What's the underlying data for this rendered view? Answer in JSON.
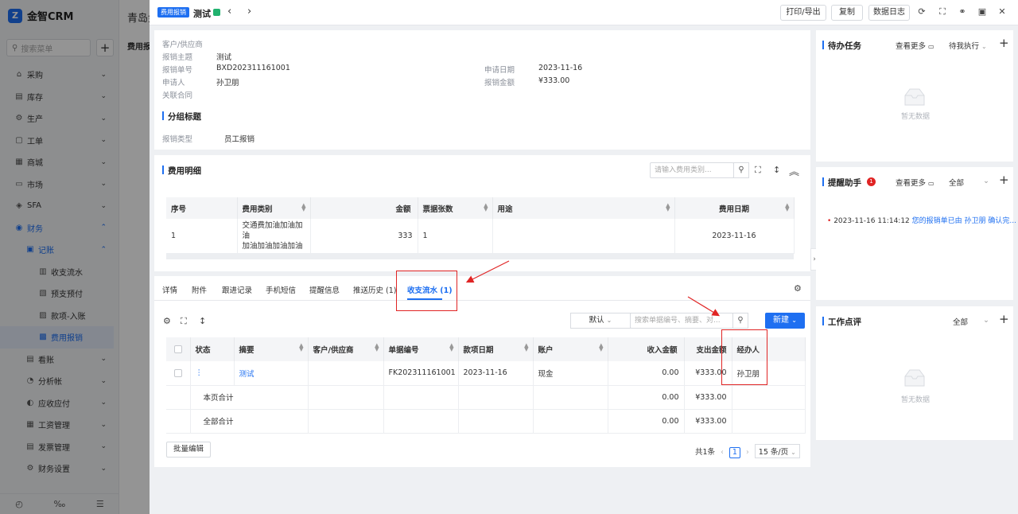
{
  "app": {
    "logo_text": "金智CRM",
    "logo_mark": "Z",
    "search_placeholder": "搜索菜单",
    "add_label": "+"
  },
  "sidebar": {
    "items": [
      {
        "icon": "cart-icon",
        "glyph": "⌂",
        "label": "采购",
        "level": 1
      },
      {
        "icon": "inventory-icon",
        "glyph": "▤",
        "label": "库存",
        "level": 1
      },
      {
        "icon": "production-icon",
        "glyph": "⚙",
        "label": "生产",
        "level": 1
      },
      {
        "icon": "workorder-icon",
        "glyph": "▢",
        "label": "工单",
        "level": 1
      },
      {
        "icon": "shop-icon",
        "glyph": "▦",
        "label": "商城",
        "level": 1
      },
      {
        "icon": "market-icon",
        "glyph": "▭",
        "label": "市场",
        "level": 1
      },
      {
        "icon": "sfa-icon",
        "glyph": "◈",
        "label": "SFA",
        "level": 1
      },
      {
        "icon": "finance-icon",
        "glyph": "◉",
        "label": "财务",
        "level": 1,
        "expanded": true
      },
      {
        "icon": "ledger-icon",
        "glyph": "▣",
        "label": "记账",
        "level": 2,
        "expanded": true
      },
      {
        "icon": "flow-icon",
        "glyph": "▥",
        "label": "收支流水",
        "level": 3
      },
      {
        "icon": "prepay-icon",
        "glyph": "▧",
        "label": "预支预付",
        "level": 3
      },
      {
        "icon": "receipt-icon",
        "glyph": "▨",
        "label": "款项-入账",
        "level": 3
      },
      {
        "icon": "expense-icon",
        "glyph": "▩",
        "label": "费用报销",
        "level": 3,
        "selected": true
      },
      {
        "icon": "report-icon",
        "glyph": "▤",
        "label": "看账",
        "level": 2
      },
      {
        "icon": "analysis-icon",
        "glyph": "◔",
        "label": "分析帐",
        "level": 2
      },
      {
        "icon": "arap-icon",
        "glyph": "◐",
        "label": "应收应付",
        "level": 2
      },
      {
        "icon": "salary-icon",
        "glyph": "▦",
        "label": "工资管理",
        "level": 2
      },
      {
        "icon": "invoice-icon",
        "glyph": "▤",
        "label": "发票管理",
        "level": 2
      },
      {
        "icon": "settings-icon",
        "glyph": "⚙",
        "label": "财务设置",
        "level": 2
      }
    ],
    "bottom": [
      "◴",
      "‰",
      "☰"
    ]
  },
  "background": {
    "title": "青岛金",
    "tab": "费用报"
  },
  "topbar": {
    "tag": "费用报销",
    "title": "测试",
    "buttons": {
      "print": "打印/导出",
      "copy": "复制",
      "log": "数据日志"
    }
  },
  "info": {
    "fields": [
      {
        "label": "客户/供应商",
        "value": ""
      },
      {
        "label": "报销主题",
        "value": "测试"
      },
      {
        "label": "报销单号",
        "value": "BXD202311161001"
      },
      {
        "label": "申请人",
        "value": "孙卫朋"
      },
      {
        "label": "关联合同",
        "value": ""
      }
    ],
    "right_fields": [
      {
        "label": "申请日期",
        "value": "2023-11-16"
      },
      {
        "label": "报销金额",
        "value": "¥333.00"
      }
    ],
    "group_title": "分组标题",
    "group_field": {
      "label": "报销类型",
      "value": "员工报销"
    }
  },
  "expense": {
    "title": "费用明细",
    "search_placeholder": "请输入费用类别...",
    "columns": [
      "序号",
      "费用类别",
      "金额",
      "票据张数",
      "用途",
      "费用日期"
    ],
    "rows": [
      {
        "no": "1",
        "category_l1": "交通费加油加油加油",
        "category_l2": "加油加油加油加油",
        "amount": "333",
        "tickets": "1",
        "purpose": "",
        "date": "2023-11-16"
      }
    ]
  },
  "flow": {
    "tabs": [
      "详情",
      "附件",
      "跟进记录",
      "手机短信",
      "提醒信息",
      "推送历史 (1)",
      "收支流水 (1)"
    ],
    "active_tab": 6,
    "filter_default": "默认",
    "search_placeholder": "搜索单据编号、摘要、对...",
    "new_label": "新建",
    "columns": [
      "状态",
      "摘要",
      "客户/供应商",
      "单据编号",
      "款项日期",
      "账户",
      "收入金额",
      "支出金额",
      "经办人"
    ],
    "rows": [
      {
        "status": "⋮",
        "summary": "测试",
        "customer": "",
        "doc_no": "FK202311161001",
        "date": "2023-11-16",
        "account": "现金",
        "income": "0.00",
        "expense": "¥333.00",
        "handler": "孙卫朋"
      }
    ],
    "page_total": {
      "label": "本页合计",
      "income": "0.00",
      "expense": "¥333.00"
    },
    "all_total": {
      "label": "全部合计",
      "income": "0.00",
      "expense": "¥333.00"
    },
    "batch_edit": "批量编辑",
    "total_count": "共1条",
    "current_page": "1",
    "page_size": "15 条/页"
  },
  "todo": {
    "title": "待办任务",
    "more": "查看更多",
    "filter": "待我执行",
    "empty": "暂无数据"
  },
  "reminder": {
    "title": "提醒助手",
    "badge": "1",
    "more": "查看更多",
    "filter": "全部",
    "item_time": "2023-11-16 11:14:12",
    "item_text": "您的报销单已由 孙卫朋 确认完..."
  },
  "review": {
    "title": "工作点评",
    "filter": "全部",
    "empty": "暂无数据"
  },
  "colors": {
    "accent": "#1e6ff1",
    "annotation": "#e02424",
    "status_green": "#21b26f"
  }
}
